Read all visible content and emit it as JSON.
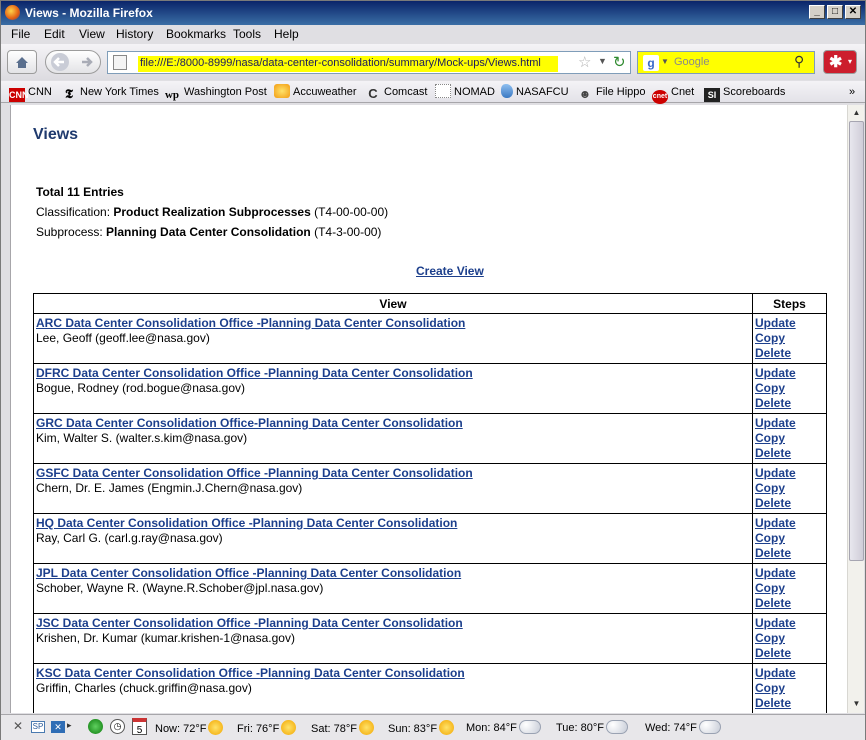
{
  "window": {
    "title": "Views - Mozilla Firefox"
  },
  "menu": [
    "File",
    "Edit",
    "View",
    "History",
    "Bookmarks",
    "Tools",
    "Help"
  ],
  "nav": {
    "url": "file:///E:/8000-8999/nasa/data-center-consolidation/summary/Mock-ups/Views.html",
    "search_placeholder": "Google"
  },
  "bookmarks": [
    {
      "label": "CNN",
      "icon": "cnn-icon",
      "color": "#cc0000"
    },
    {
      "label": "New York Times",
      "icon": "nyt-icon",
      "color": "#000000"
    },
    {
      "label": "Washington Post",
      "icon": "wp-icon",
      "color": "#000000"
    },
    {
      "label": "Accuweather",
      "icon": "accuweather-icon",
      "color": "#f29b12"
    },
    {
      "label": "Comcast",
      "icon": "comcast-icon",
      "color": "#333333"
    },
    {
      "label": "NOMAD",
      "icon": "nomad-icon",
      "color": "#9a9a9a"
    },
    {
      "label": "NASAFCU",
      "icon": "nasafcu-icon",
      "color": "#3a78c2"
    },
    {
      "label": "File Hippo",
      "icon": "filehippo-icon",
      "color": "#444444"
    },
    {
      "label": "Cnet",
      "icon": "cnet-icon",
      "color": "#cc0000"
    },
    {
      "label": "Scoreboards",
      "icon": "si-icon",
      "color": "#222222"
    }
  ],
  "page": {
    "title": "Views",
    "total": "Total 11 Entries",
    "classification_label": "Classification:",
    "classification_value": "Product Realization Subprocesses",
    "classification_code": "(T4-00-00-00)",
    "subprocess_label": "Subprocess:",
    "subprocess_value": "Planning Data Center Consolidation",
    "subprocess_code": "(T4-3-00-00)",
    "create_link": "Create View",
    "table": {
      "headers": [
        "View",
        "Steps"
      ],
      "rows": [
        {
          "title": "ARC Data Center Consolidation Office -Planning Data Center Consolidation",
          "owner": "Lee, Geoff (geoff.lee@nasa.gov)"
        },
        {
          "title": "DFRC Data Center Consolidation Office -Planning Data Center Consolidation",
          "owner": "Bogue, Rodney (rod.bogue@nasa.gov)"
        },
        {
          "title": "GRC Data Center Consolidation Office-Planning Data Center Consolidation",
          "owner": "Kim, Walter S. (walter.s.kim@nasa.gov)"
        },
        {
          "title": "GSFC Data Center Consolidation Office -Planning Data Center Consolidation",
          "owner": "Chern, Dr. E. James (Engmin.J.Chern@nasa.gov)"
        },
        {
          "title": "HQ Data Center Consolidation Office -Planning Data Center Consolidation",
          "owner": "Ray, Carl G. (carl.g.ray@nasa.gov)"
        },
        {
          "title": "JPL Data Center Consolidation Office -Planning Data Center Consolidation",
          "owner": "Schober, Wayne R. (Wayne.R.Schober@jpl.nasa.gov)"
        },
        {
          "title": "JSC Data Center Consolidation Office -Planning Data Center Consolidation",
          "owner": "Krishen, Dr. Kumar (kumar.krishen-1@nasa.gov)"
        },
        {
          "title": "KSC Data Center Consolidation Office -Planning Data Center Consolidation",
          "owner": "Griffin, Charles (chuck.griffin@nasa.gov)"
        }
      ],
      "step_links": [
        "Update",
        "Copy",
        "Delete"
      ]
    }
  },
  "status": {
    "weather": [
      {
        "label": "Now: 72°F",
        "icon": "sun-icon"
      },
      {
        "label": "Fri: 76°F",
        "icon": "sun-icon"
      },
      {
        "label": "Sat: 78°F",
        "icon": "sun-icon"
      },
      {
        "label": "Sun: 83°F",
        "icon": "sun-icon"
      },
      {
        "label": "Mon: 84°F",
        "icon": "partly-cloudy-icon"
      },
      {
        "label": "Tue: 80°F",
        "icon": "partly-cloudy-icon"
      },
      {
        "label": "Wed: 74°F",
        "icon": "rain-cloud-icon"
      }
    ],
    "calendar_day": "5"
  }
}
